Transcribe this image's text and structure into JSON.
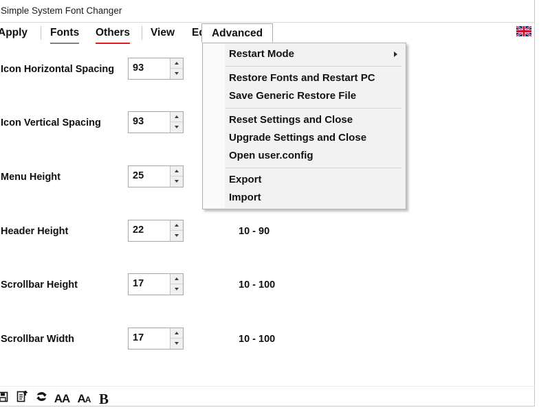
{
  "window": {
    "title": "Simple System Font Changer"
  },
  "menubar": {
    "items": [
      {
        "label": "Apply",
        "state": "normal"
      },
      {
        "label": "Fonts",
        "state": "underline-gray"
      },
      {
        "label": "Others",
        "state": "underline-red"
      },
      {
        "label": "View",
        "state": "normal"
      },
      {
        "label": "Edit",
        "state": "normal"
      },
      {
        "label": "Advanced",
        "state": "open"
      }
    ],
    "flag_icon": "union-jack-flag-icon",
    "flag_label": "English"
  },
  "advanced_menu": {
    "open": true,
    "items": [
      {
        "label": "Restart Mode",
        "submenu": true
      },
      {
        "separator": true
      },
      {
        "label": "Restore Fonts and Restart PC",
        "submenu": false
      },
      {
        "label": "Save Generic Restore File",
        "submenu": false
      },
      {
        "separator": true
      },
      {
        "label": "Reset Settings and Close",
        "submenu": false
      },
      {
        "label": "Upgrade Settings and Close",
        "submenu": false
      },
      {
        "label": "Open user.config",
        "submenu": false
      },
      {
        "separator": true
      },
      {
        "label": "Export",
        "submenu": false
      },
      {
        "label": "Import",
        "submenu": false
      }
    ]
  },
  "settings": {
    "rows": [
      {
        "label": "Icon Horizontal Spacing",
        "value": "93",
        "range": ""
      },
      {
        "label": "Icon Vertical Spacing",
        "value": "93",
        "range": ""
      },
      {
        "label": "Menu Height",
        "value": "25",
        "range": ""
      },
      {
        "label": "Header Height",
        "value": "22",
        "range": "10 - 90"
      },
      {
        "label": "Scrollbar Height",
        "value": "17",
        "range": "10 - 100"
      },
      {
        "label": "Scrollbar Width",
        "value": "17",
        "range": "10 - 100"
      }
    ]
  },
  "toolbar": {
    "icons": [
      {
        "name": "save-icon",
        "glyph": "⊡"
      },
      {
        "name": "export-document-icon",
        "glyph": "὎4"
      },
      {
        "name": "refresh-icon",
        "glyph": "↻"
      },
      {
        "name": "increase-font-icon",
        "glyph": "AA"
      },
      {
        "name": "decrease-font-icon",
        "glyph": "Aa"
      },
      {
        "name": "bold-icon",
        "glyph": "B"
      }
    ]
  },
  "colors": {
    "accent_red": "#e01b1b",
    "accent_gray": "#808080",
    "text": "#101010",
    "menu_bg": "#f2f2f2",
    "border": "#b4b4b4"
  }
}
